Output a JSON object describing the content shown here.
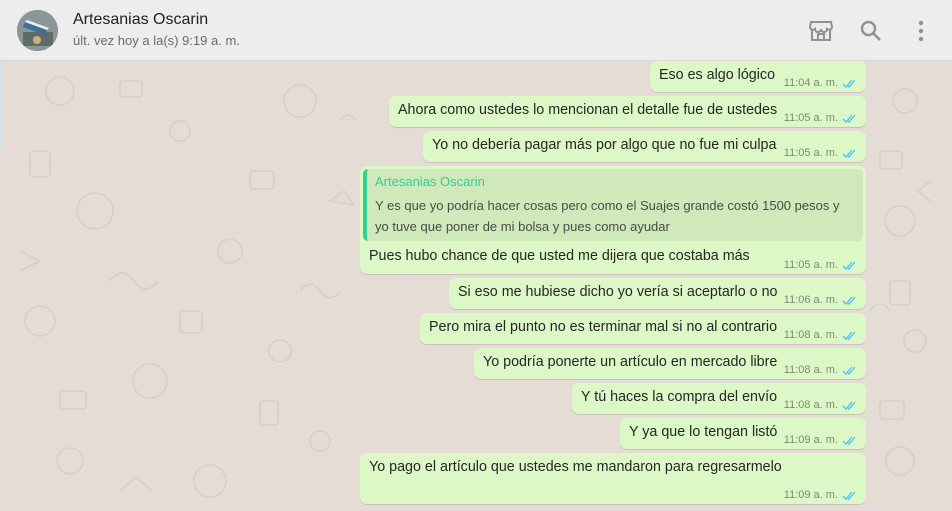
{
  "header": {
    "contact_name": "Artesanias Oscarin",
    "last_seen": "últ. vez hoy a la(s) 9:19 a. m.",
    "icons": [
      "store-icon",
      "search-icon",
      "menu-kebab-icon"
    ]
  },
  "colors": {
    "outgoing_bubble": "#dcf8c6",
    "chat_background": "#e5ddd5",
    "read_ticks": "#4fc3f7",
    "quote_accent": "#35cd96"
  },
  "messages": [
    {
      "text": "Eso es algo lógico",
      "time": "11:04 a. m."
    },
    {
      "text": "Ahora como ustedes lo mencionan el detalle fue de ustedes",
      "time": "11:05 a. m."
    },
    {
      "text": "Yo no debería pagar más por algo que no fue mi culpa",
      "time": "11:05 a. m."
    },
    {
      "quote": {
        "author": "Artesanias Oscarin",
        "line1": "Y es que yo podría hacer cosas pero como el Suajes grande costó 1500 pesos y",
        "line2": "yo tuve que poner de mi bolsa y pues como ayudar"
      },
      "text": "Pues hubo chance de que usted me dijera que costaba más",
      "time": "11:05 a. m."
    },
    {
      "text": "Si eso me hubiese dicho yo vería si aceptarlo o no",
      "time": "11:06 a. m."
    },
    {
      "text": "Pero mira el punto no es terminar mal si no al contrario",
      "time": "11:08 a. m."
    },
    {
      "text": "Yo podría ponerte un artículo en mercado libre",
      "time": "11:08 a. m."
    },
    {
      "text": "Y tú haces la compra del envío",
      "time": "11:08 a. m."
    },
    {
      "text": "Y ya que lo tengan listó",
      "time": "11:09 a. m."
    },
    {
      "text": "Yo pago el artículo que ustedes me mandaron para regresarmelo",
      "time": "11:09 a. m."
    }
  ]
}
